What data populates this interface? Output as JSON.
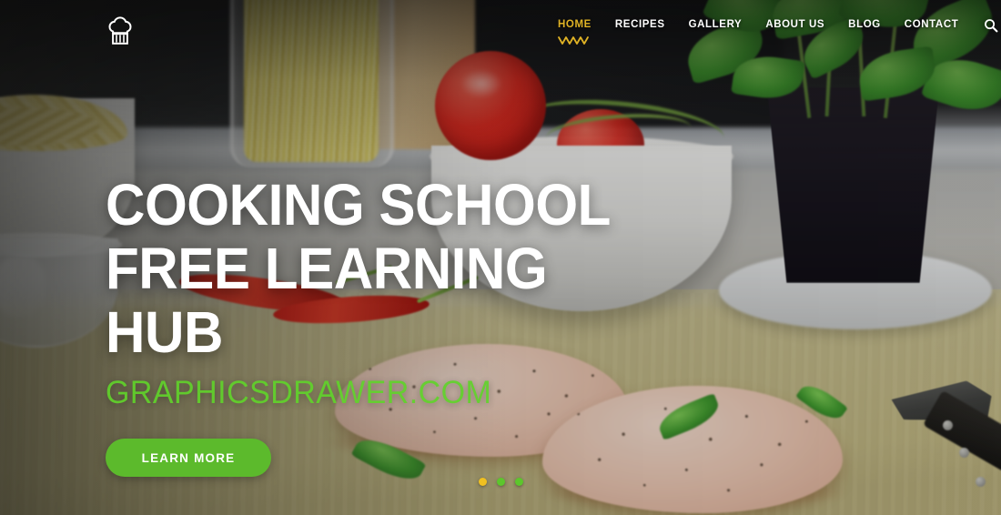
{
  "site": {
    "logo_icon": "chef-hat-icon"
  },
  "nav": {
    "items": [
      {
        "label": "HOME",
        "active": true
      },
      {
        "label": "RECIPES",
        "active": false
      },
      {
        "label": "GALLERY",
        "active": false
      },
      {
        "label": "ABOUT US",
        "active": false
      },
      {
        "label": "BLOG",
        "active": false
      },
      {
        "label": "CONTACT",
        "active": false
      }
    ],
    "search_icon": "search-icon",
    "active_indicator_icon": "zigzag-underline-icon",
    "active_color": "#e0b325",
    "link_color": "#ffffff"
  },
  "hero": {
    "title": "COOKING SCHOOL FREE LEARNING HUB",
    "subtitle": "GRAPHICSDRAWER.COM",
    "button_label": "LEARN MORE",
    "button_color": "#5cba2c",
    "subtitle_color": "#5fd12a",
    "title_color": "#ffffff"
  },
  "carousel": {
    "slides": [
      {
        "index": 1,
        "active": true
      },
      {
        "index": 2,
        "active": false
      },
      {
        "index": 3,
        "active": false
      }
    ],
    "active_dot_color": "#f0c020",
    "inactive_dot_color": "#5cc62c"
  }
}
